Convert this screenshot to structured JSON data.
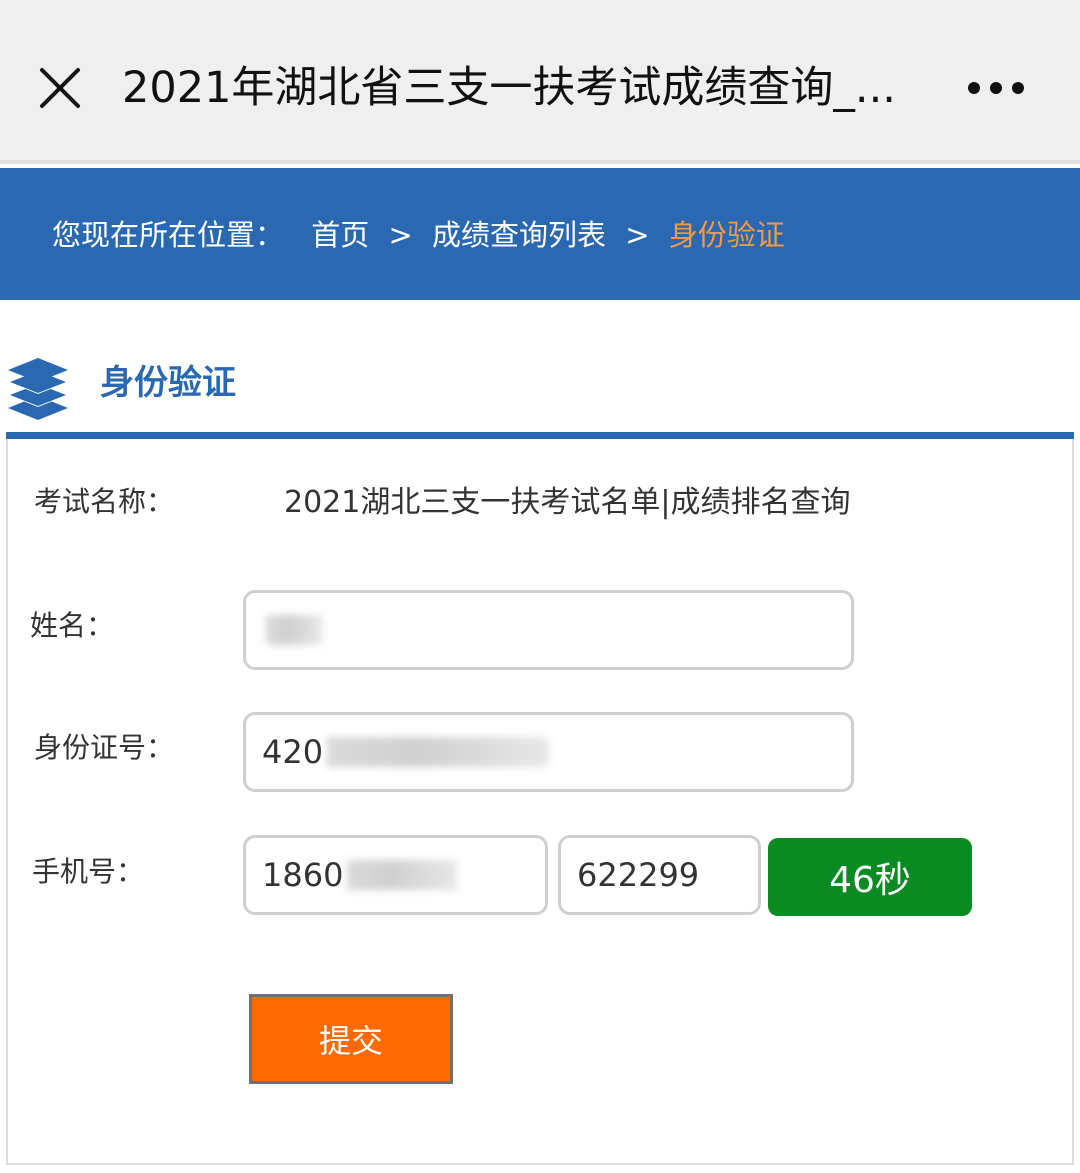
{
  "header": {
    "title": "2021年湖北省三支一扶考试成绩查询_..."
  },
  "breadcrumb": {
    "prefix": "您现在所在位置：",
    "items": [
      "首页",
      "成绩查询列表",
      "身份验证"
    ],
    "separator": ">"
  },
  "section": {
    "title": "身份验证"
  },
  "form": {
    "exam_label": "考试名称：",
    "exam_value": "2021湖北三支一扶考试名单|成绩排名查询",
    "name_label": "姓名：",
    "name_value": "",
    "id_label": "身份证号：",
    "id_value": "420",
    "phone_label": "手机号：",
    "phone_value": "1860",
    "code_value": "622299",
    "countdown_label": "46秒",
    "submit_label": "提交"
  },
  "colors": {
    "accent_blue": "#2a69b2",
    "breadcrumb_current": "#f39a43",
    "countdown_green": "#0a8b21",
    "submit_orange": "#ff6a00"
  }
}
